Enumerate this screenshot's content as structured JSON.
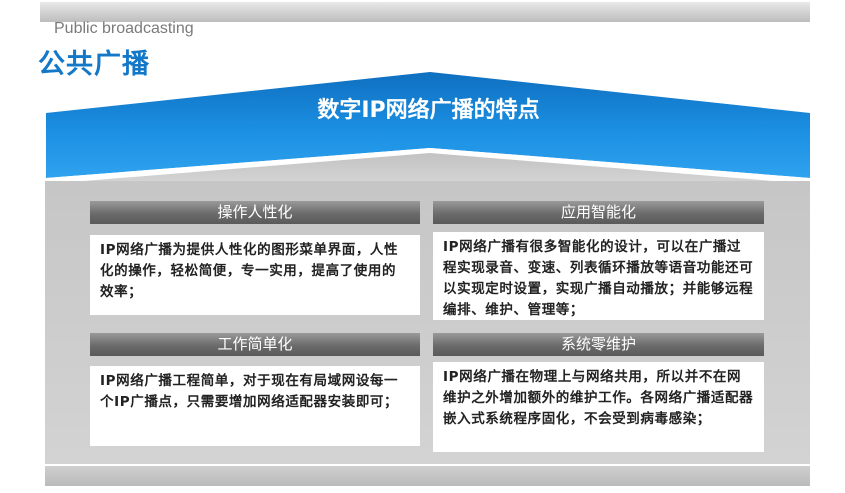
{
  "header": {
    "subtitle_en": "Public broadcasting",
    "title_cn": "公共广播"
  },
  "banner": {
    "title": "数字IP网络广播的特点"
  },
  "features": [
    {
      "heading": "操作人性化",
      "text": "IP网络广播为提供人性化的图形菜单界面，人性化的操作，轻松简便，专一实用，提高了使用的效率；"
    },
    {
      "heading": "应用智能化",
      "text": "IP网络广播有很多智能化的设计，可以在广播过程实现录音、变速、列表循环播放等语音功能还可以实现定时设置，实现广播自动播放；并能够远程编排、维护、管理等；"
    },
    {
      "heading": "工作简单化",
      "text": "IP网络广播工程简单，对于现在有局域网设每一个IP广播点，只需要增加网络适配器安装即可；"
    },
    {
      "heading": "系统零维护",
      "text": "IP网络广播在物理上与网络共用，所以并不在网维护之外增加额外的维护工作。各网络广播适配器嵌入式系统程序固化，不会受到病毒感染；"
    }
  ],
  "colors": {
    "accent_blue": "#1478c8",
    "banner_blue": "#1a8be0",
    "panel_gray": "#cbcbcb",
    "header_gray": "#6b6b6b"
  }
}
